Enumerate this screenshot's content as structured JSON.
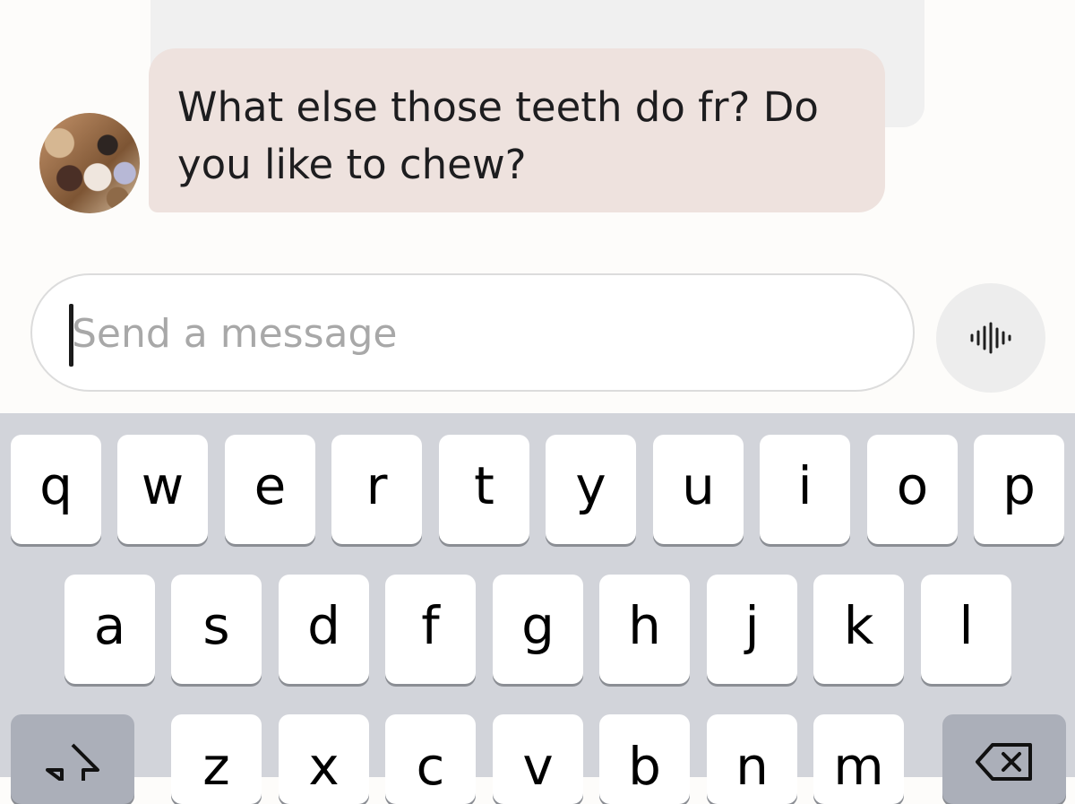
{
  "chat": {
    "incoming_message": "What else those teeth do fr? Do you like to chew?"
  },
  "composer": {
    "placeholder": "Send a message",
    "voice_icon": "audio-waveform-icon"
  },
  "keyboard": {
    "row1": [
      "q",
      "w",
      "e",
      "r",
      "t",
      "y",
      "u",
      "i",
      "o",
      "p"
    ],
    "row2": [
      "a",
      "s",
      "d",
      "f",
      "g",
      "h",
      "j",
      "k",
      "l"
    ],
    "row3": [
      "z",
      "x",
      "c",
      "v",
      "b",
      "n",
      "m"
    ],
    "shift_icon": "shift-arrow-icon",
    "delete_icon": "backspace-icon",
    "colors": {
      "background": "#d2d4da",
      "key": "#ffffff",
      "function_key": "#abafb9"
    }
  },
  "colors": {
    "incoming_bubble": "#eee2de",
    "previous_bubble": "#f0f0f0",
    "page_background": "#fdfcfa"
  }
}
